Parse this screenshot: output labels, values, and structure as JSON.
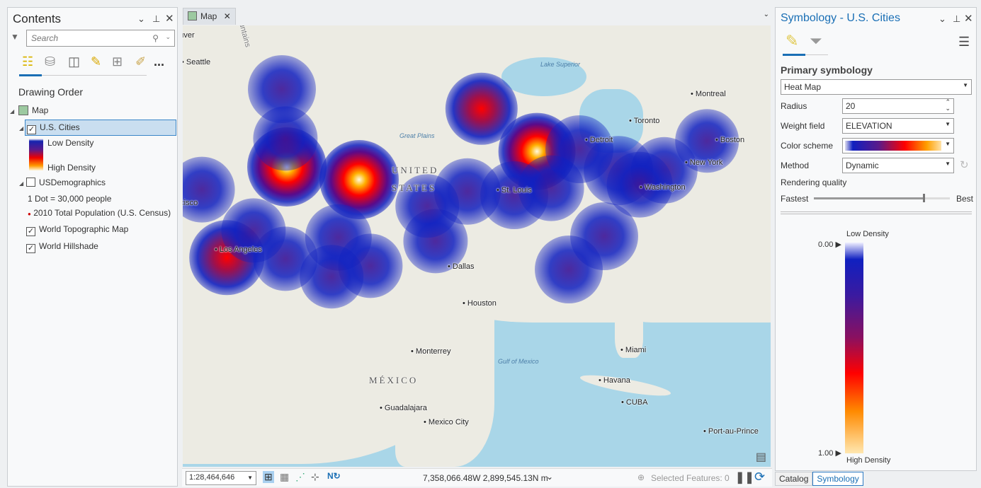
{
  "contents": {
    "title": "Contents",
    "search_placeholder": "Search",
    "more": "...",
    "section": "Drawing Order",
    "map_label": "Map",
    "layers": [
      {
        "name": "U.S. Cities",
        "checked": true,
        "legend": {
          "low": "Low Density",
          "high": "High Density"
        }
      },
      {
        "name": "USDemographics",
        "checked": false,
        "note": "1 Dot = 30,000 people",
        "legend_item": "2010 Total Population (U.S. Census)"
      },
      {
        "name": "World Topographic Map",
        "checked": true
      },
      {
        "name": "World Hillshade",
        "checked": true
      }
    ]
  },
  "map": {
    "tab": "Map",
    "scale": "1:28,464,646",
    "coordinates": "7,358,066.48W 2,899,545.13N m",
    "selected_features": "Selected Features: 0",
    "labels": {
      "vancouver": "Vancouver",
      "seattle": "Seattle",
      "lake_superior": "Lake Superior",
      "montreal": "Montreal",
      "toronto": "Toronto",
      "great_plains": "Great Plains",
      "united": "UNITED",
      "states": "STATES",
      "boston": "Boston",
      "new_york": "New York",
      "washington": "Washington",
      "san_francisco": "San Francisco",
      "los_angeles": "Los Angeles",
      "st_louis": "St. Louis",
      "detroit": "Detroit",
      "dallas": "Dallas",
      "houston": "Houston",
      "monterrey": "Monterrey",
      "gulf": "Gulf of Mexico",
      "miami": "Miami",
      "mexico": "MÉXICO",
      "havana": "Havana",
      "cuba": "CUBA",
      "guadalajara": "Guadalajara",
      "mexico_city": "Mexico City",
      "port_au_prince": "Port-au-Prince",
      "mountains": "Mountains"
    }
  },
  "symbology": {
    "title": "Symbology - U.S. Cities",
    "primary": "Primary symbology",
    "type": "Heat Map",
    "radius_label": "Radius",
    "radius": "20",
    "weight_label": "Weight field",
    "weight": "ELEVATION",
    "scheme_label": "Color scheme",
    "method_label": "Method",
    "method": "Dynamic",
    "quality_label": "Rendering quality",
    "fastest": "Fastest",
    "best": "Best",
    "quality_value": 0.8,
    "legend_low": "Low Density",
    "legend_high": "High Density",
    "tick_low": "0.00",
    "tick_high": "1.00"
  },
  "bottom_tabs": [
    "Catalog",
    "Symbology"
  ]
}
